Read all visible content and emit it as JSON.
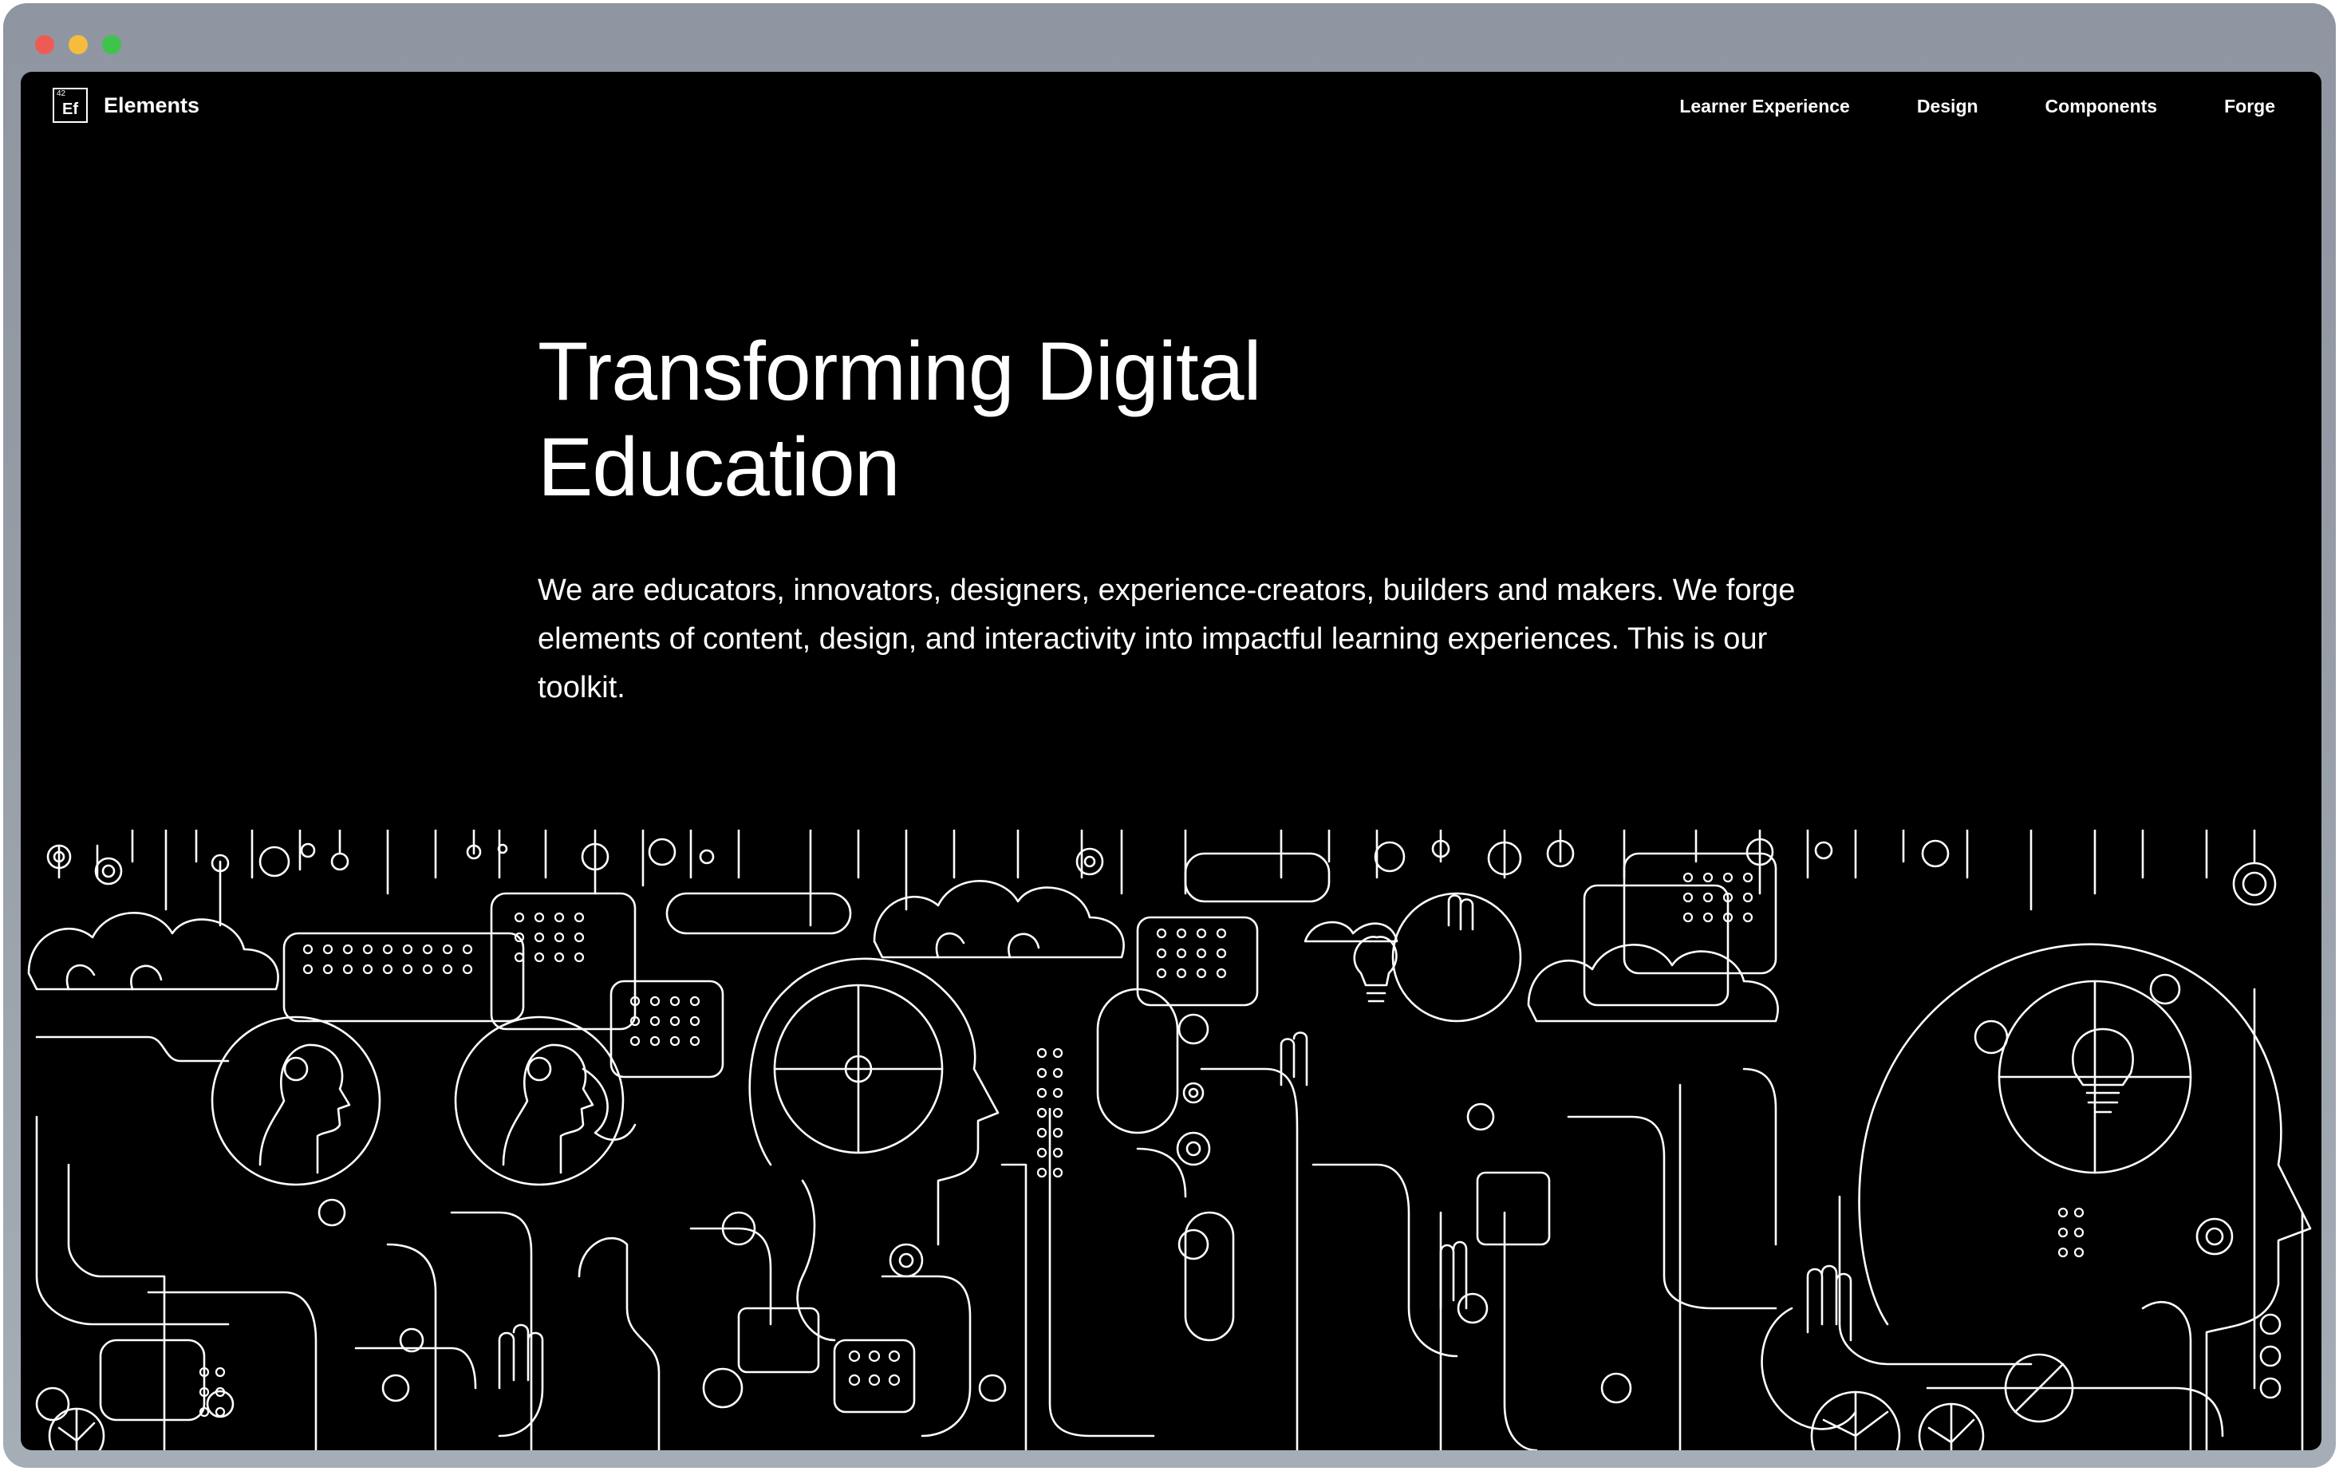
{
  "window": {
    "controls": [
      "close",
      "minimize",
      "zoom"
    ]
  },
  "logo": {
    "number": "42",
    "symbol": "Ef",
    "name": "Elements"
  },
  "nav": {
    "items": [
      {
        "label": "Learner Experience"
      },
      {
        "label": "Design"
      },
      {
        "label": "Components"
      },
      {
        "label": "Forge"
      }
    ]
  },
  "hero": {
    "title_line1": "Transforming Digital",
    "title_line2": "Education",
    "description": "We are educators, innovators, designers, experience-creators, builders and makers. We forge elements of content, design, and interactivity into impactful learning experiences. This is our toolkit."
  },
  "colors": {
    "background": "#000000",
    "text": "#ffffff",
    "chrome": "#959ca6",
    "close": "#ee5b54",
    "minimize": "#f5bd3b",
    "zoom": "#3fc34b"
  },
  "illustration": {
    "icon": "circuit-people-lineart",
    "style": "white line art on black"
  }
}
